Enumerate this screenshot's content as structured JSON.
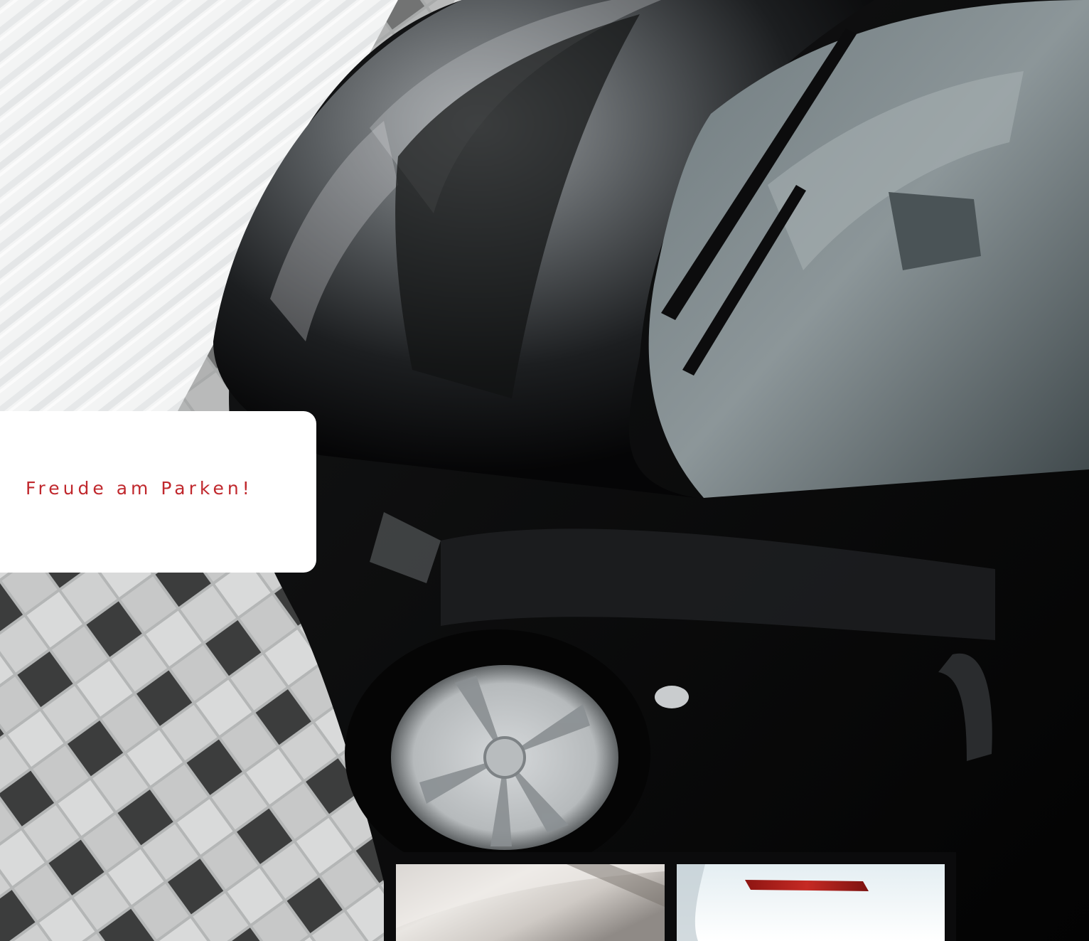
{
  "caption": {
    "text": "Freude am Parken!"
  },
  "images": {
    "main": "car-hood-parking-photo",
    "thumb_left": "silver-car-detail-photo",
    "thumb_right": "white-car-rear-reflector-photo"
  },
  "colors": {
    "caption_text": "#c0282d",
    "card_background": "#ffffff",
    "frame_black": "#0b0b0c"
  }
}
